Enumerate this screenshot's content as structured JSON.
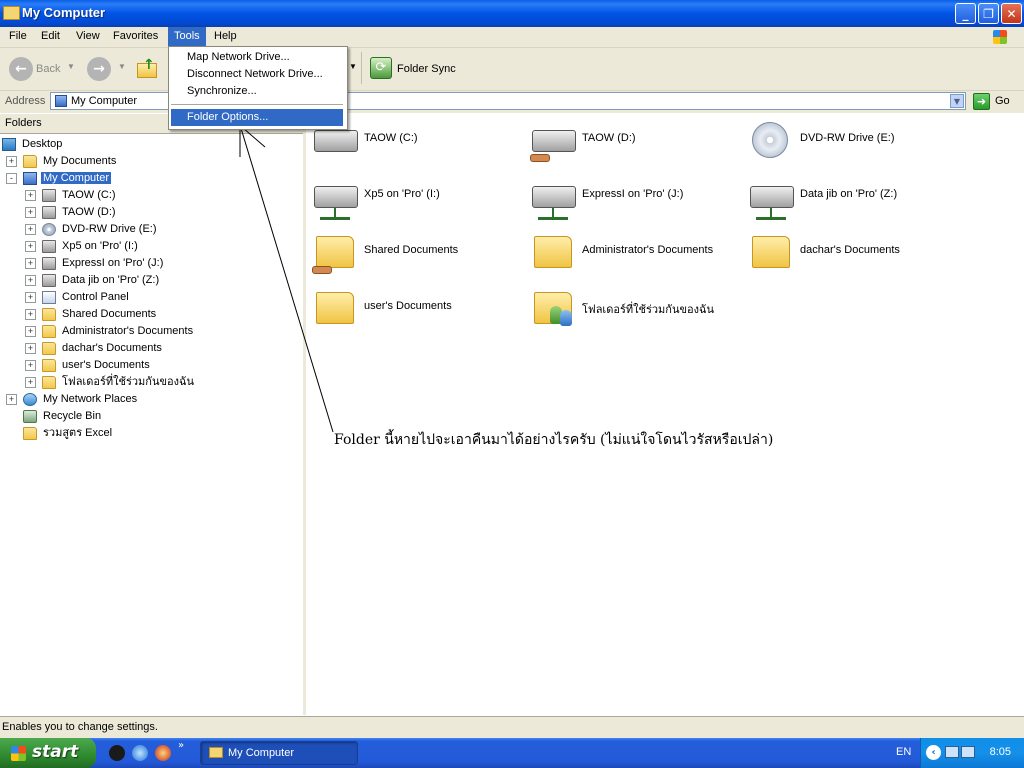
{
  "window": {
    "title": "My Computer"
  },
  "menubar": {
    "items": [
      "File",
      "Edit",
      "View",
      "Favorites",
      "Tools",
      "Help"
    ],
    "active": "Tools"
  },
  "tools_menu": {
    "items": [
      "Map Network Drive...",
      "Disconnect Network Drive...",
      "Synchronize...",
      "Folder Options..."
    ],
    "highlighted": "Folder Options..."
  },
  "toolbar": {
    "back_label": "Back",
    "folder_sync_label": "Folder Sync"
  },
  "address": {
    "label": "Address",
    "value": "My Computer",
    "go_label": "Go"
  },
  "folders_pane": {
    "header": "Folders",
    "tree": [
      {
        "label": "Desktop",
        "level": 0,
        "expander": "",
        "icon": "desktop-icon"
      },
      {
        "label": "My Documents",
        "level": 1,
        "expander": "+",
        "icon": "folder-icon"
      },
      {
        "label": "My Computer",
        "level": 1,
        "expander": "-",
        "icon": "computer-icon",
        "selected": true
      },
      {
        "label": "TAOW (C:)",
        "level": 2,
        "expander": "+",
        "icon": "drive-icon"
      },
      {
        "label": "TAOW (D:)",
        "level": 2,
        "expander": "+",
        "icon": "shared-drive-icon"
      },
      {
        "label": "DVD-RW Drive (E:)",
        "level": 2,
        "expander": "+",
        "icon": "dvd-drive-icon"
      },
      {
        "label": "Xp5 on 'Pro' (I:)",
        "level": 2,
        "expander": "+",
        "icon": "network-drive-icon"
      },
      {
        "label": "ExpressI on 'Pro' (J:)",
        "level": 2,
        "expander": "+",
        "icon": "network-drive-icon"
      },
      {
        "label": "Data   jib on 'Pro' (Z:)",
        "level": 2,
        "expander": "+",
        "icon": "network-drive-icon"
      },
      {
        "label": "Control Panel",
        "level": 2,
        "expander": "+",
        "icon": "control-panel-icon"
      },
      {
        "label": "Shared Documents",
        "level": 2,
        "expander": "+",
        "icon": "folder-icon"
      },
      {
        "label": "Administrator's Documents",
        "level": 2,
        "expander": "+",
        "icon": "folder-icon"
      },
      {
        "label": "dachar's Documents",
        "level": 2,
        "expander": "+",
        "icon": "folder-icon"
      },
      {
        "label": "user's Documents",
        "level": 2,
        "expander": "+",
        "icon": "folder-icon"
      },
      {
        "label": "โฟลเดอร์ที่ใช้ร่วมกันของฉัน",
        "level": 2,
        "expander": "+",
        "icon": "shared-folder-icon"
      },
      {
        "label": "My Network Places",
        "level": 1,
        "expander": "+",
        "icon": "network-places-icon"
      },
      {
        "label": "Recycle Bin",
        "level": 1,
        "expander": "",
        "icon": "recycle-bin-icon"
      },
      {
        "label": "รวมสูตร Excel",
        "level": 1,
        "expander": "",
        "icon": "folder-icon"
      }
    ]
  },
  "content_items": [
    {
      "label": "TAOW (C:)",
      "icon": "drive-icon"
    },
    {
      "label": "TAOW (D:)",
      "icon": "shared-drive-icon"
    },
    {
      "label": "DVD-RW Drive (E:)",
      "icon": "dvd-drive-icon"
    },
    {
      "label": "Xp5 on 'Pro' (I:)",
      "icon": "network-drive-icon"
    },
    {
      "label": "ExpressI on 'Pro' (J:)",
      "icon": "network-drive-icon"
    },
    {
      "label": "Data   jib on 'Pro' (Z:)",
      "icon": "network-drive-icon"
    },
    {
      "label": "Shared Documents",
      "icon": "shared-folder-icon"
    },
    {
      "label": "Administrator's Documents",
      "icon": "folder-icon"
    },
    {
      "label": "dachar's Documents",
      "icon": "folder-icon"
    },
    {
      "label": "user's Documents",
      "icon": "folder-icon"
    },
    {
      "label": "โฟลเดอร์ที่ใช้ร่วมกันของฉัน",
      "icon": "users-folder-icon"
    }
  ],
  "annotation": "Folder นี้หายไปจะเอาคืนมาได้อย่างไรครับ (ไม่แน่ใจโดนไวรัสหรือเปล่า)",
  "statusbar": {
    "text": "Enables you to change settings."
  },
  "taskbar": {
    "start_label": "start",
    "task_label": "My Computer",
    "language": "EN",
    "clock": "8:05"
  },
  "colors": {
    "titlebar": "#0054e3",
    "selection": "#316ac5",
    "chrome": "#ece9d8",
    "start_green": "#2f8a2f"
  }
}
